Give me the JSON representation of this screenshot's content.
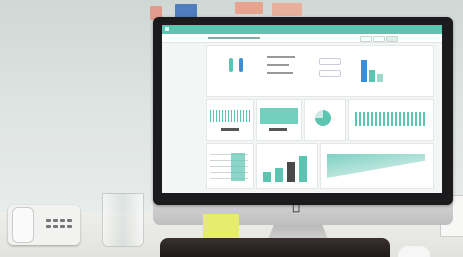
{
  "scene": {
    "colors": {
      "accent": "#5bc5b2",
      "accent_blue": "#3b8fd8",
      "sticky_note": "#e6ec6d",
      "wall": "#dfe5e3"
    },
    "icons": [
      "apple-logo-icon"
    ]
  },
  "dashboard": {
    "header_color": "#5bc5b2",
    "panels": [
      "overview",
      "line-chart",
      "bar-chart",
      "donut-chart",
      "area-chart",
      "list",
      "bars",
      "trend"
    ]
  }
}
